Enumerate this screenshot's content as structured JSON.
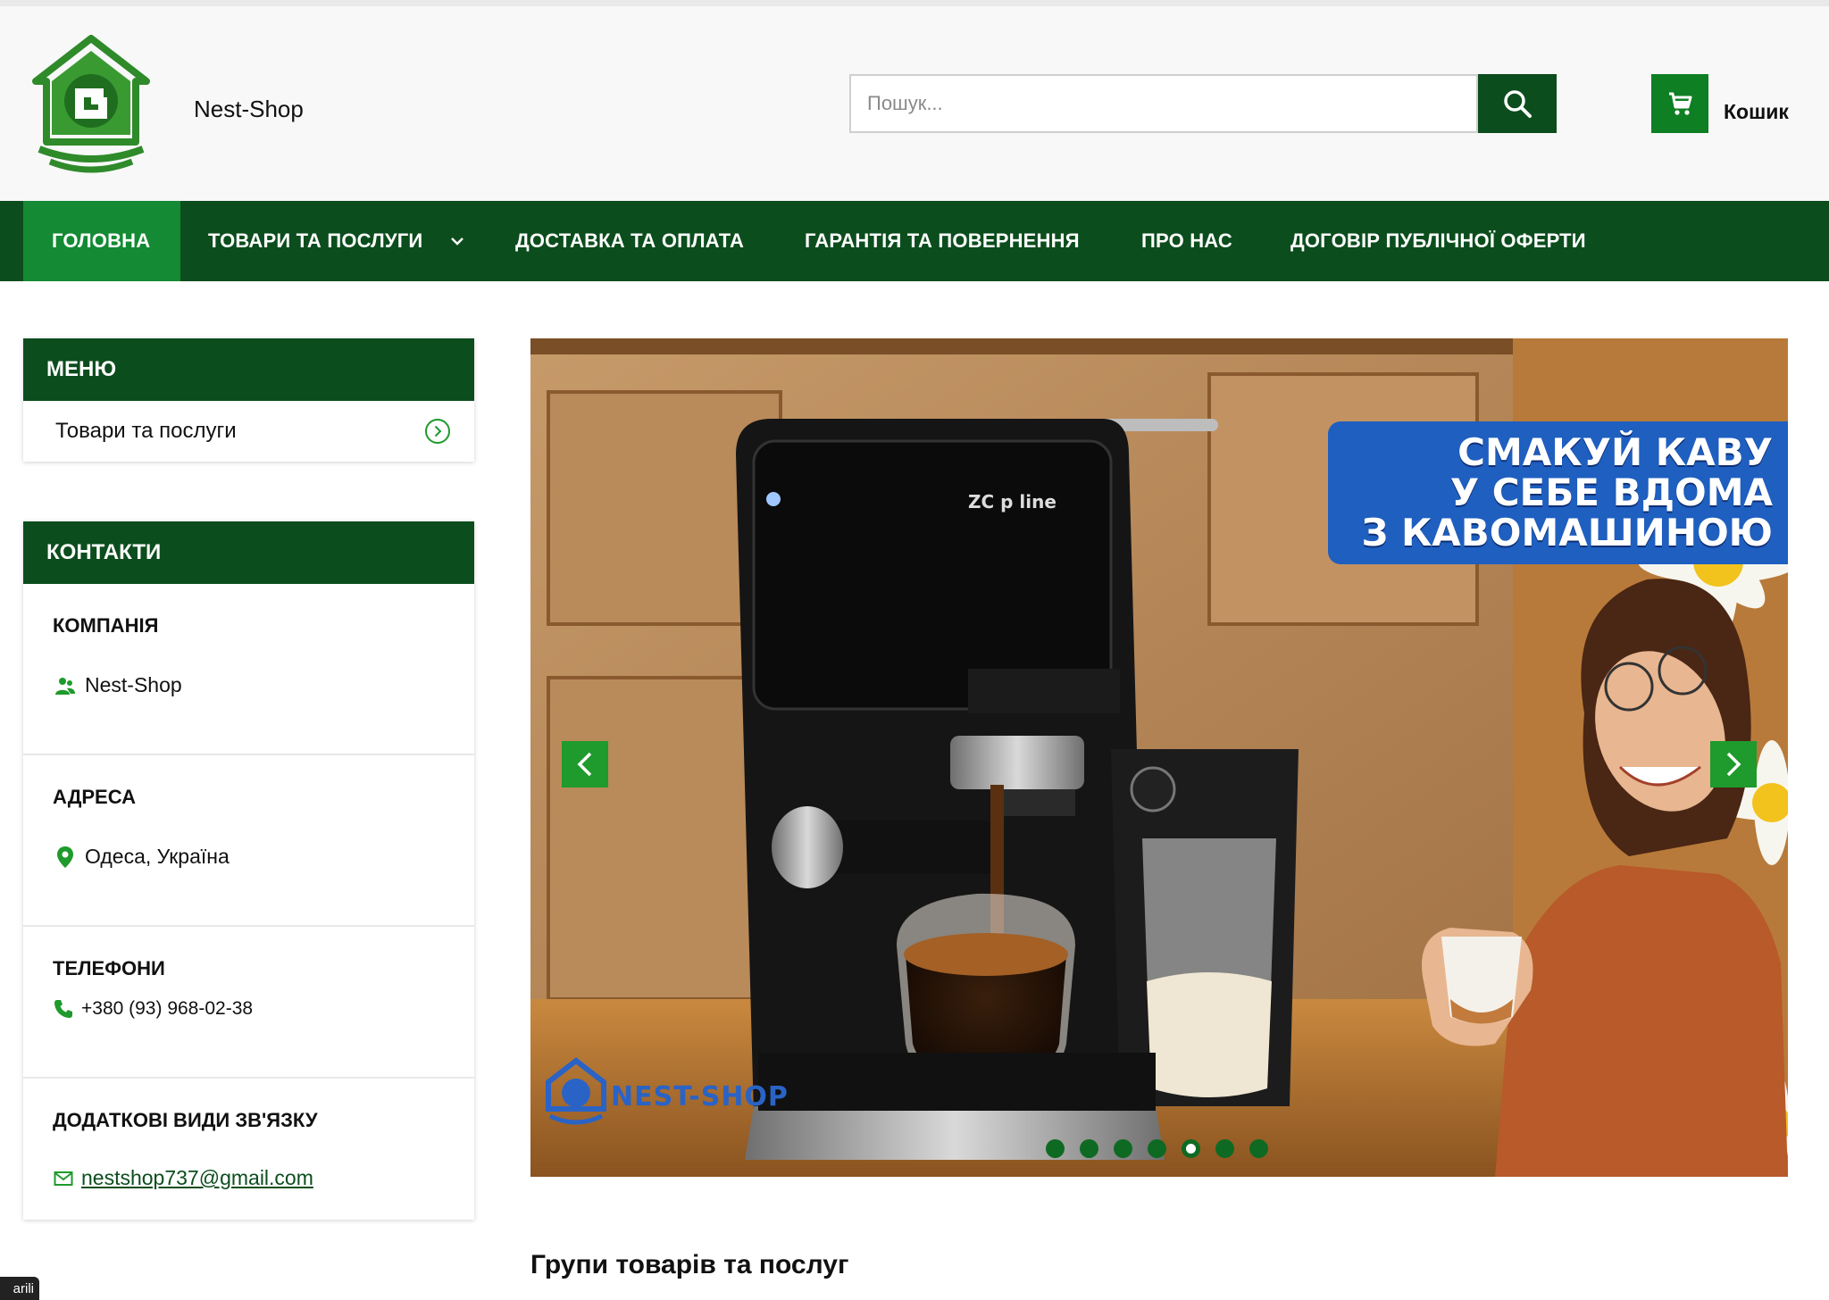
{
  "header": {
    "brand_name": "Nest-Shop",
    "search": {
      "placeholder": "Пошук...",
      "value": ""
    },
    "cart_label": "Кошик"
  },
  "nav": {
    "items": [
      {
        "label": "ГОЛОВНА",
        "active": true
      },
      {
        "label": "ТОВАРИ ТА ПОСЛУГИ",
        "active": false
      },
      {
        "label": "ДОСТАВКА ТА ОПЛАТА",
        "active": false
      },
      {
        "label": "ГАРАНТІЯ ТА ПОВЕРНЕННЯ",
        "active": false
      },
      {
        "label": "ПРО НАС",
        "active": false
      },
      {
        "label": "ДОГОВІР ПУБЛІЧНОЇ ОФЕРТИ",
        "active": false
      }
    ]
  },
  "sidebar": {
    "menu": {
      "title": "МЕНЮ",
      "items": [
        {
          "label": "Товари та послуги"
        }
      ]
    },
    "contacts": {
      "title": "КОНТАКТИ",
      "company": {
        "title": "КОМПАНІЯ",
        "value": "Nest-Shop"
      },
      "address": {
        "title": "АДРЕСА",
        "value": "Одеса, Україна"
      },
      "phones": {
        "title": "ТЕЛЕФОНИ",
        "value": "+380 (93) 968-02-38"
      },
      "extra": {
        "title": "ДОДАТКОВІ ВИДИ ЗВ'ЯЗКУ",
        "email": "nestshop737@gmail.com"
      }
    }
  },
  "banner": {
    "slogan": [
      "СМАКУЙ КАВУ",
      "У СЕБЕ ВДОМА",
      "З КАВОМАШИНОЮ"
    ],
    "watermark": "NEST-SHOP",
    "slides_count": 7,
    "active_slide": 5
  },
  "groups_title": "Групи товарів та послуг",
  "corner_badge": "arili",
  "colors": {
    "nav_bg": "#0c4d1d",
    "nav_active": "#138a33",
    "cart_green": "#0e7f22",
    "slider_arrow": "#1f9a2c",
    "slogan_bg": "#1e5fc0"
  },
  "icons": {
    "search": "search-icon",
    "cart": "cart-icon",
    "menu_item": "chevron-right-circle-icon",
    "company": "users-icon",
    "address": "map-pin-icon",
    "phone": "phone-icon",
    "email": "envelope-icon"
  }
}
